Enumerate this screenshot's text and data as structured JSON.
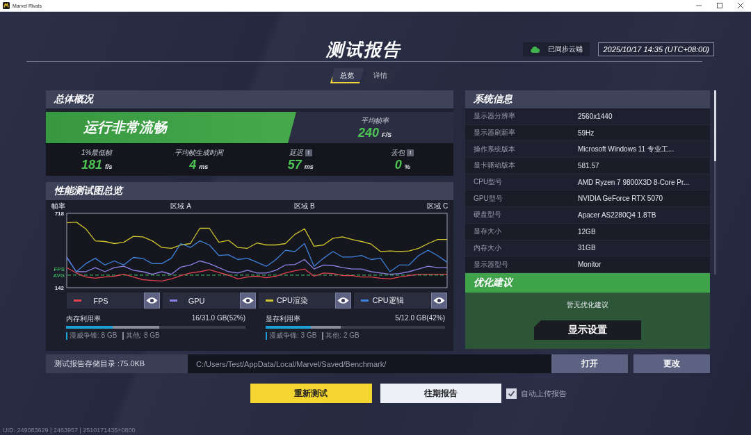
{
  "window": {
    "title": "Marvel Rivals"
  },
  "header": {
    "title": "测试报告",
    "sync_status": "已同步云端",
    "timestamp": "2025/10/17 14:35 (UTC+08:00)"
  },
  "tabs": [
    {
      "label": "总览",
      "selected": true
    },
    {
      "label": "详情",
      "selected": false
    }
  ],
  "overview": {
    "title": "总体概况",
    "status": "运行非常流畅",
    "average": {
      "label": "平均帧率",
      "value": "240",
      "unit": "F/S"
    },
    "stats": [
      {
        "label": "1%最低帧",
        "value": "181",
        "unit": "f/s"
      },
      {
        "label": "平均帧生成时间",
        "value": "4",
        "unit": "ms"
      },
      {
        "label": "延迟",
        "badge": "!",
        "value": "57",
        "unit": "ms"
      },
      {
        "label": "丢包",
        "badge": "!",
        "value": "0",
        "unit": "%"
      }
    ]
  },
  "performance": {
    "title": "性能测试图总览",
    "chart_data": {
      "type": "line",
      "ylabel": "帧率",
      "categories": [
        null,
        null,
        null,
        null,
        null,
        null,
        null,
        null,
        null,
        null,
        null,
        null,
        "区域 A",
        null,
        null,
        null,
        null,
        null,
        null,
        null,
        null,
        null,
        null,
        null,
        null,
        "区域 B",
        null,
        null,
        null,
        null,
        null,
        null,
        null,
        null,
        null,
        null,
        null,
        null,
        null,
        "区域 C",
        null
      ],
      "ylim": [
        142,
        718
      ],
      "yticks": [
        142,
        718
      ],
      "ref_lines": [
        {
          "axis": "y",
          "value": 240,
          "label": "FPS AVG",
          "color": "#3ba55c",
          "line_style": "dashed"
        }
      ],
      "legend": "bottom",
      "series": [
        {
          "name": "FPS",
          "color": "#e0434f",
          "values": [
            297,
            256,
            225,
            215,
            225,
            231,
            246,
            225,
            204,
            198,
            194,
            210,
            235,
            256,
            266,
            281,
            260,
            239,
            210,
            225,
            231,
            219,
            231,
            256,
            273,
            287,
            231,
            256,
            252,
            235,
            235,
            225,
            225,
            215,
            210,
            225,
            235,
            246,
            246,
            246,
            246
          ]
        },
        {
          "name": "GPU",
          "color": "#8f82e6",
          "values": [
            380,
            266,
            266,
            297,
            266,
            297,
            308,
            277,
            266,
            246,
            266,
            246,
            302,
            318,
            349,
            328,
            297,
            266,
            256,
            277,
            256,
            256,
            277,
            318,
            322,
            360,
            287,
            318,
            314,
            297,
            287,
            287,
            266,
            256,
            246,
            252,
            266,
            287,
            308,
            297,
            297
          ]
        },
        {
          "name": "CPU渲染",
          "color": "#cfc52c",
          "values": [
            645,
            650,
            598,
            505,
            500,
            484,
            494,
            540,
            536,
            505,
            453,
            447,
            473,
            484,
            602,
            602,
            494,
            509,
            453,
            447,
            488,
            473,
            473,
            484,
            556,
            598,
            463,
            473,
            525,
            536,
            515,
            500,
            480,
            422,
            426,
            422,
            426,
            447,
            484,
            515,
            515
          ]
        },
        {
          "name": "CPU逻辑",
          "color": "#3f82dc",
          "values": [
            374,
            266,
            328,
            370,
            318,
            349,
            318,
            376,
            368,
            328,
            328,
            370,
            484,
            453,
            505,
            473,
            391,
            397,
            360,
            370,
            339,
            308,
            360,
            432,
            422,
            484,
            308,
            370,
            422,
            380,
            380,
            391,
            360,
            370,
            266,
            318,
            318,
            391,
            432,
            391,
            339
          ]
        }
      ]
    },
    "memory": [
      {
        "label": "内存利用率",
        "reading": "16/31.0 GB(52%)",
        "level": 0.52,
        "segments": [
          {
            "label": "漫威争锋: 8 GB",
            "level": 0.26,
            "color": "#1e9fd6"
          },
          {
            "label": "其他: 8 GB",
            "color": "#8a8d99"
          }
        ]
      },
      {
        "label": "显存利用率",
        "reading": "5/12.0 GB(42%)",
        "level": 0.42,
        "segments": [
          {
            "label": "漫威争锋: 3 GB",
            "level": 0.25,
            "color": "#1e9fd6"
          },
          {
            "label": "其他: 2 GB",
            "color": "#8a8d99"
          }
        ]
      }
    ]
  },
  "system_info": {
    "title": "系统信息",
    "rows": [
      {
        "label": "显示器分辨率",
        "value": "2560x1440"
      },
      {
        "label": "显示器刷新率",
        "value": "59Hz"
      },
      {
        "label": "操作系统版本",
        "value": "Microsoft Windows 11 专业工..."
      },
      {
        "label": "显卡驱动版本",
        "value": "581.57"
      },
      {
        "label": "CPU型号",
        "value": "AMD Ryzen 7 9800X3D 8-Core Pr..."
      },
      {
        "label": "GPU型号",
        "value": "NVIDIA GeForce RTX 5070"
      },
      {
        "label": "硬盘型号",
        "value": "Apacer AS2280Q4 1.8TB"
      },
      {
        "label": "显存大小",
        "value": "12GB"
      },
      {
        "label": "内存大小",
        "value": "31GB"
      },
      {
        "label": "显示器型号",
        "value": "Monitor"
      }
    ]
  },
  "advice": {
    "title": "优化建议",
    "message": "暂无优化建议",
    "button": "显示设置"
  },
  "storage": {
    "label": "测试报告存储目录 :75.0KB",
    "path": "C:/Users/Test/AppData/Local/Marvel/Saved/Benchmark/",
    "buttons": [
      "打开",
      "更改"
    ]
  },
  "actions": {
    "buttons": [
      {
        "label": "重新测试",
        "kind": "primary"
      },
      {
        "label": "往期报告",
        "kind": "secondary"
      }
    ],
    "auto_upload": {
      "label": "自动上传报告",
      "checked": true
    }
  },
  "footer": {
    "uid": "UID: 249083629 | 2463957 | 2510171435+0800"
  }
}
